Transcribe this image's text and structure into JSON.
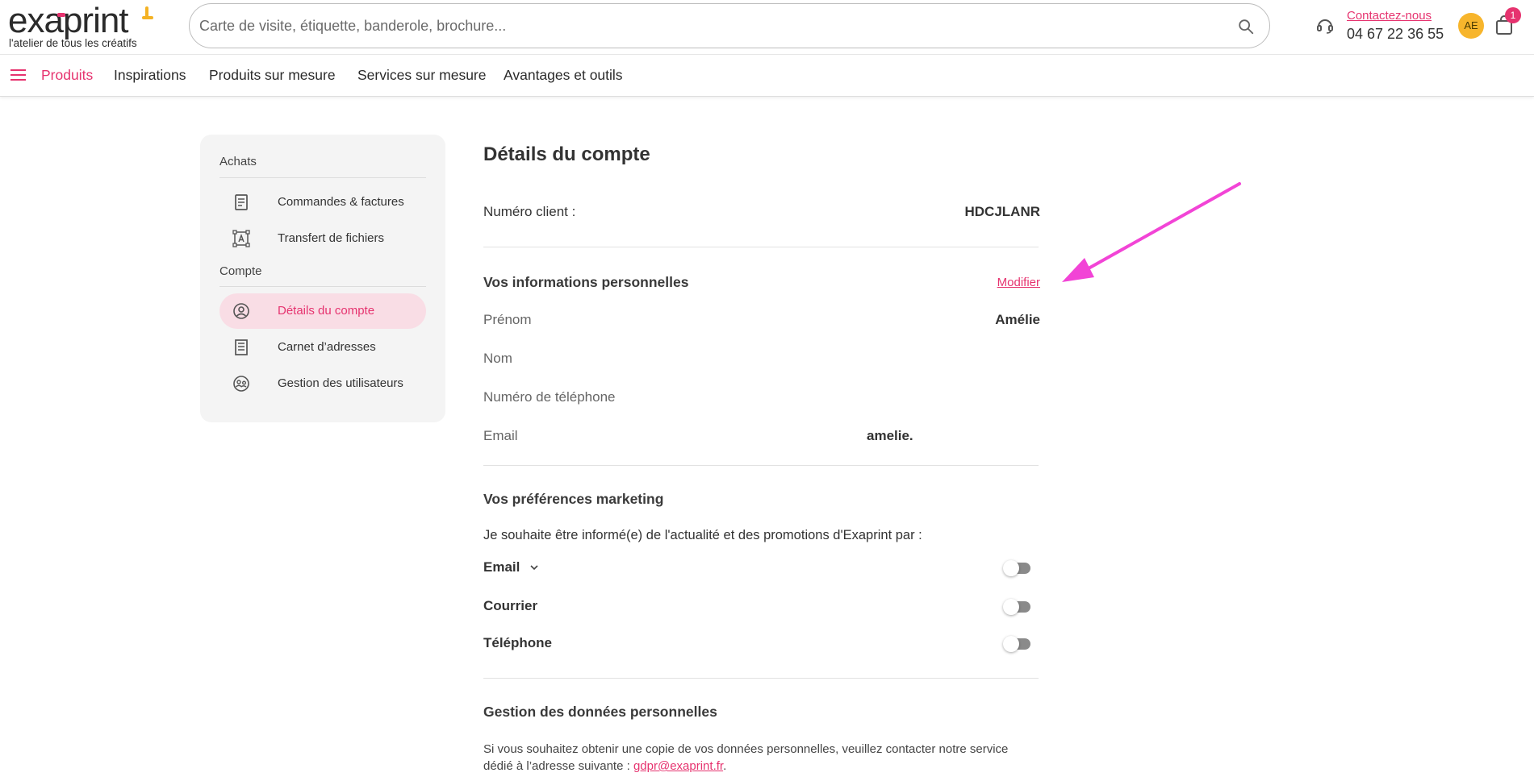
{
  "header": {
    "logo_text": "exaprint",
    "logo_tagline": "l'atelier de tous les créatifs",
    "search_placeholder": "Carte de visite, étiquette, banderole, brochure...",
    "contact_link": "Contactez-nous",
    "contact_phone": "04 67 22 36 55",
    "avatar_initials": "AE",
    "cart_count": "1"
  },
  "nav": {
    "items": [
      "Produits",
      "Inspirations",
      "Produits sur mesure",
      "Services sur mesure",
      "Avantages et outils"
    ]
  },
  "sidebar": {
    "section_achats": "Achats",
    "section_compte": "Compte",
    "items": [
      {
        "label": "Commandes & factures",
        "icon": "receipt-icon"
      },
      {
        "label": "Transfert de fichiers",
        "icon": "file-transfer-icon"
      },
      {
        "label": "Détails du compte",
        "icon": "user-circle-icon"
      },
      {
        "label": "Carnet d’adresses",
        "icon": "address-book-icon"
      },
      {
        "label": "Gestion des utilisateurs",
        "icon": "users-icon"
      }
    ]
  },
  "main": {
    "title": "Détails du compte",
    "client_label": "Numéro client :",
    "client_value": "HDCJLANR",
    "personal_title": "Vos informations personnelles",
    "modify_label": "Modifier",
    "fields": {
      "prenom_label": "Prénom",
      "prenom_value": "Amélie",
      "nom_label": "Nom",
      "phone_label": "Numéro de téléphone",
      "email_label": "Email",
      "email_value": "amelie."
    },
    "marketing_title": "Vos préférences marketing",
    "marketing_intro": "Je souhaite être informé(e) de l'actualité et des promotions d'Exaprint par :",
    "prefs": [
      {
        "label": "Email",
        "enabled": false
      },
      {
        "label": "Courrier",
        "enabled": false
      },
      {
        "label": "Téléphone",
        "enabled": false
      }
    ],
    "gdpr_title": "Gestion des données personnelles",
    "gdpr_text_1": "Si vous souhaitez obtenir une copie de vos données personnelles, veuillez contacter notre service dédié à l’adresse suivante : ",
    "gdpr_email": "gdpr@exaprint.fr",
    "gdpr_text_2": "."
  },
  "colors": {
    "accent": "#e6336f",
    "avatar": "#f7b52c",
    "annotation_arrow": "#f244d6"
  }
}
